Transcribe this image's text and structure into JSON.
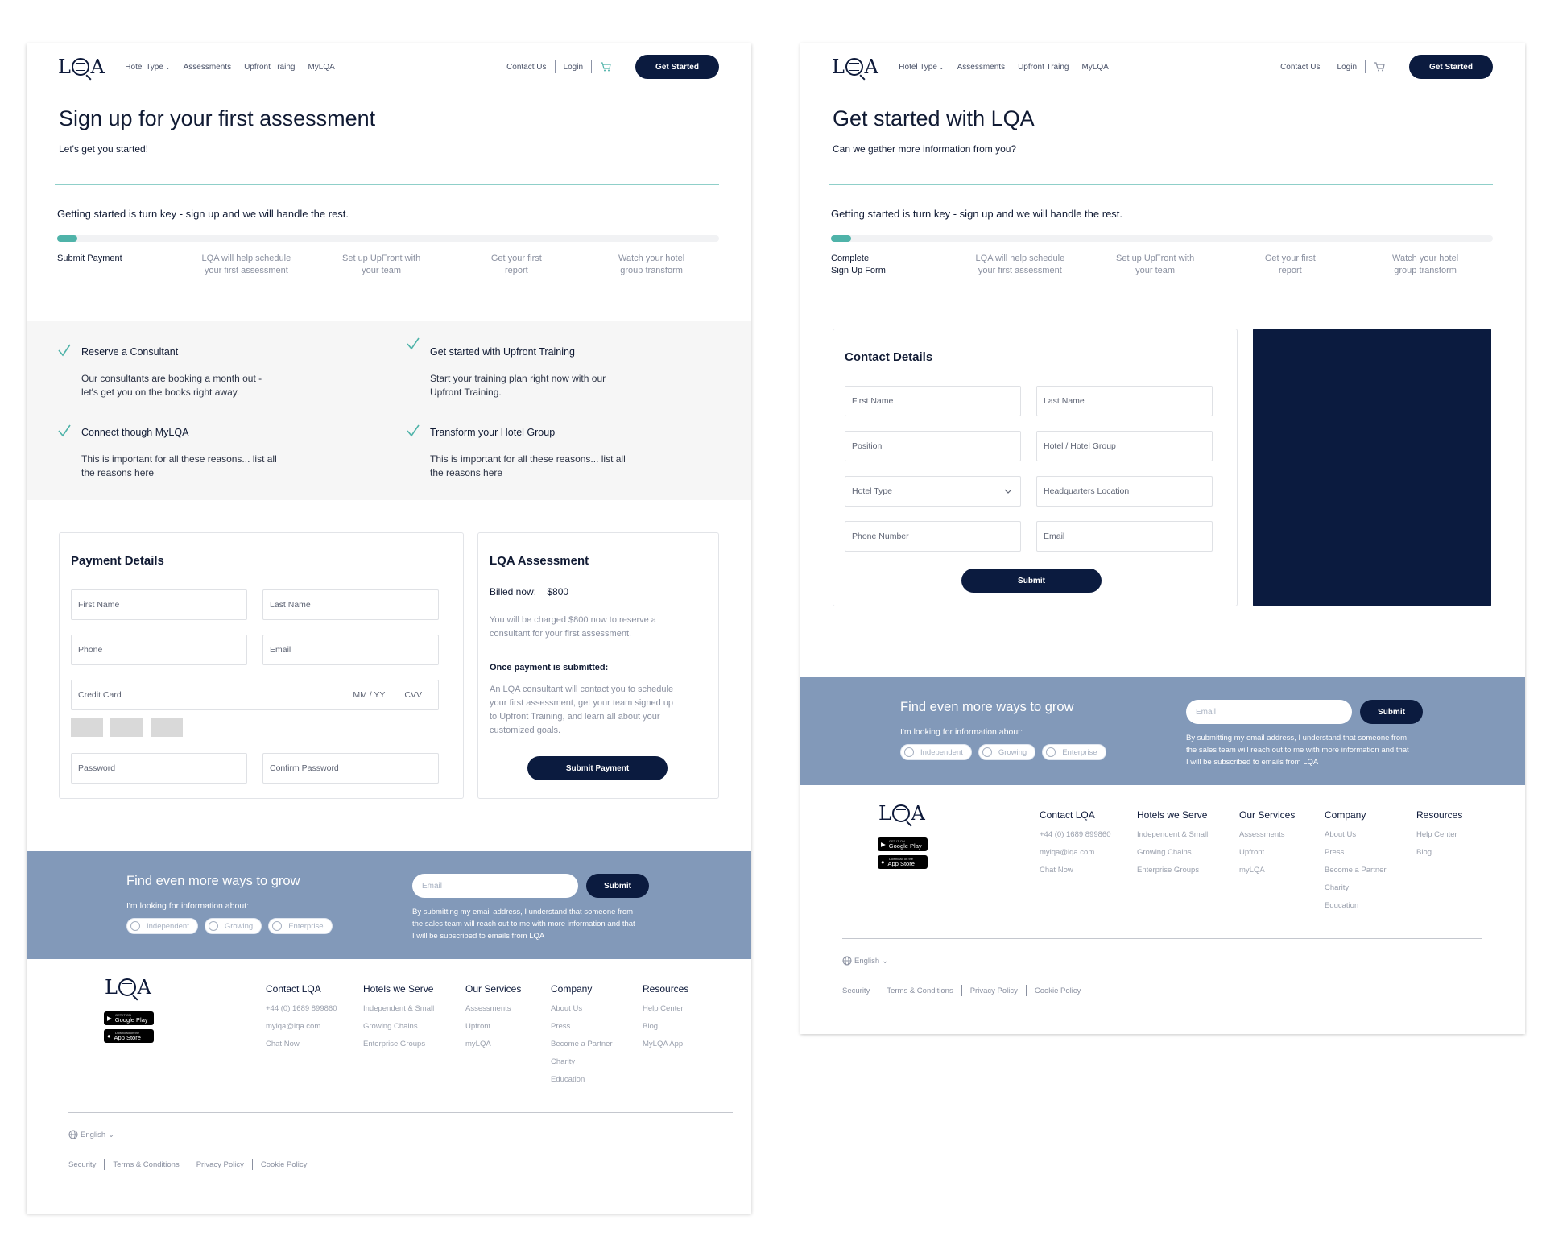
{
  "nav": {
    "links": [
      "Hotel Type",
      "Assessments",
      "Upfront Traing",
      "MyLQA"
    ],
    "contact": "Contact Us",
    "login": "Login",
    "cta": "Get Started"
  },
  "logo": {
    "l": "L",
    "a": "A"
  },
  "left": {
    "title": "Sign up for your first assessment",
    "subtitle": "Let's get you started!",
    "turnkey": "Getting started is turn key - sign up and we will handle the rest.",
    "progress": 0.03,
    "steps": [
      [
        "Submit Payment",
        ""
      ],
      [
        "LQA will help schedule",
        "your first assessment"
      ],
      [
        "Set up UpFront with",
        "your team"
      ],
      [
        "Get your first",
        "report"
      ],
      [
        "Watch your hotel",
        "group transform"
      ]
    ],
    "benefits": [
      {
        "title": "Reserve a Consultant",
        "l1": "Our consultants are booking a month out -",
        "l2": "let's get you on the books right away."
      },
      {
        "title": "Get started with Upfront Training",
        "l1": "Start your training plan right now with our",
        "l2": "Upfront Training."
      },
      {
        "title": "Connect though MyLQA",
        "l1": "This is important for all these reasons... list all",
        "l2": "the reasons here"
      },
      {
        "title": "Transform your Hotel Group",
        "l1": "This is important for all these reasons... list all",
        "l2": "the reasons here"
      }
    ],
    "payment": {
      "title": "Payment Details",
      "first_name": "First Name",
      "last_name": "Last Name",
      "phone": "Phone",
      "email": "Email",
      "credit_card": "Credit Card",
      "mmyy": "MM / YY",
      "cvv": "CVV",
      "password": "Password",
      "confirm_password": "Confirm Password"
    },
    "assessment": {
      "title": "LQA Assessment",
      "billed_label": "Billed now:",
      "billed_value": "$800",
      "charge_l1": "You will be charged $800 now to reserve a",
      "charge_l2": "consultant for your first assessment.",
      "once_label": "Once payment is submitted:",
      "once_l1": "An LQA consultant will contact you to schedule",
      "once_l2": "your first assessment, get your team signed up",
      "once_l3": "to Upfront Training, and learn all about your",
      "once_l4": "customized goals.",
      "submit": "Submit Payment"
    }
  },
  "right": {
    "title": "Get started with LQA",
    "subtitle": "Can we gather more information from you?",
    "turnkey": "Getting started is turn key - sign up and we will handle the rest.",
    "progress": 0.03,
    "steps": [
      [
        "Complete",
        "Sign Up Form"
      ],
      [
        "LQA will help schedule",
        "your first assessment"
      ],
      [
        "Set up UpFront with",
        "your team"
      ],
      [
        "Get your first",
        "report"
      ],
      [
        "Watch your hotel",
        "group transform"
      ]
    ],
    "contact": {
      "title": "Contact Details",
      "first_name": "First Name",
      "last_name": "Last Name",
      "position": "Position",
      "hotel_group": "Hotel / Hotel Group",
      "hotel_type": "Hotel Type",
      "hq": "Headquarters Location",
      "phone": "Phone Number",
      "email": "Email",
      "submit": "Submit"
    }
  },
  "newsletter": {
    "title": "Find even more ways to grow",
    "sub": "I'm looking for information about:",
    "options": [
      "Independent",
      "Growing",
      "Enterprise"
    ],
    "email_placeholder": "Email",
    "submit": "Submit",
    "legal_l1": "By submitting my email address, I understand that someone from",
    "legal_l2": "the sales team will reach out to me with more information and that",
    "legal_l3": "I will be subscribed to emails from LQA"
  },
  "footer": {
    "google_small": "GET IT ON",
    "google": "Google Play",
    "apple_small": "Download on the",
    "apple": "App Store",
    "columns": [
      {
        "title": "Contact LQA",
        "items": [
          "+44 (0) 1689 899860",
          "mylqa@lqa.com",
          "Chat Now"
        ]
      },
      {
        "title": "Hotels we Serve",
        "items": [
          "Independent & Small",
          "Growing Chains",
          "Enterprise Groups"
        ]
      },
      {
        "title": "Our Services",
        "items": [
          "Assessments",
          "Upfront",
          "myLQA"
        ]
      },
      {
        "title": "Company",
        "items": [
          "About Us",
          "Press",
          "Become a Partner",
          "Charity",
          "Education"
        ]
      }
    ],
    "resources_title": "Resources",
    "resources_left": [
      "Help Center",
      "Blog",
      "MyLQA App"
    ],
    "resources_right": [
      "Help Center",
      "Blog"
    ],
    "language": "English",
    "legal": [
      "Security",
      "Terms & Conditions",
      "Privacy Policy",
      "Cookie Policy"
    ]
  },
  "colors": {
    "navy": "#0b1b3f",
    "teal": "#4fb3a9",
    "slate": "#8299b9"
  }
}
